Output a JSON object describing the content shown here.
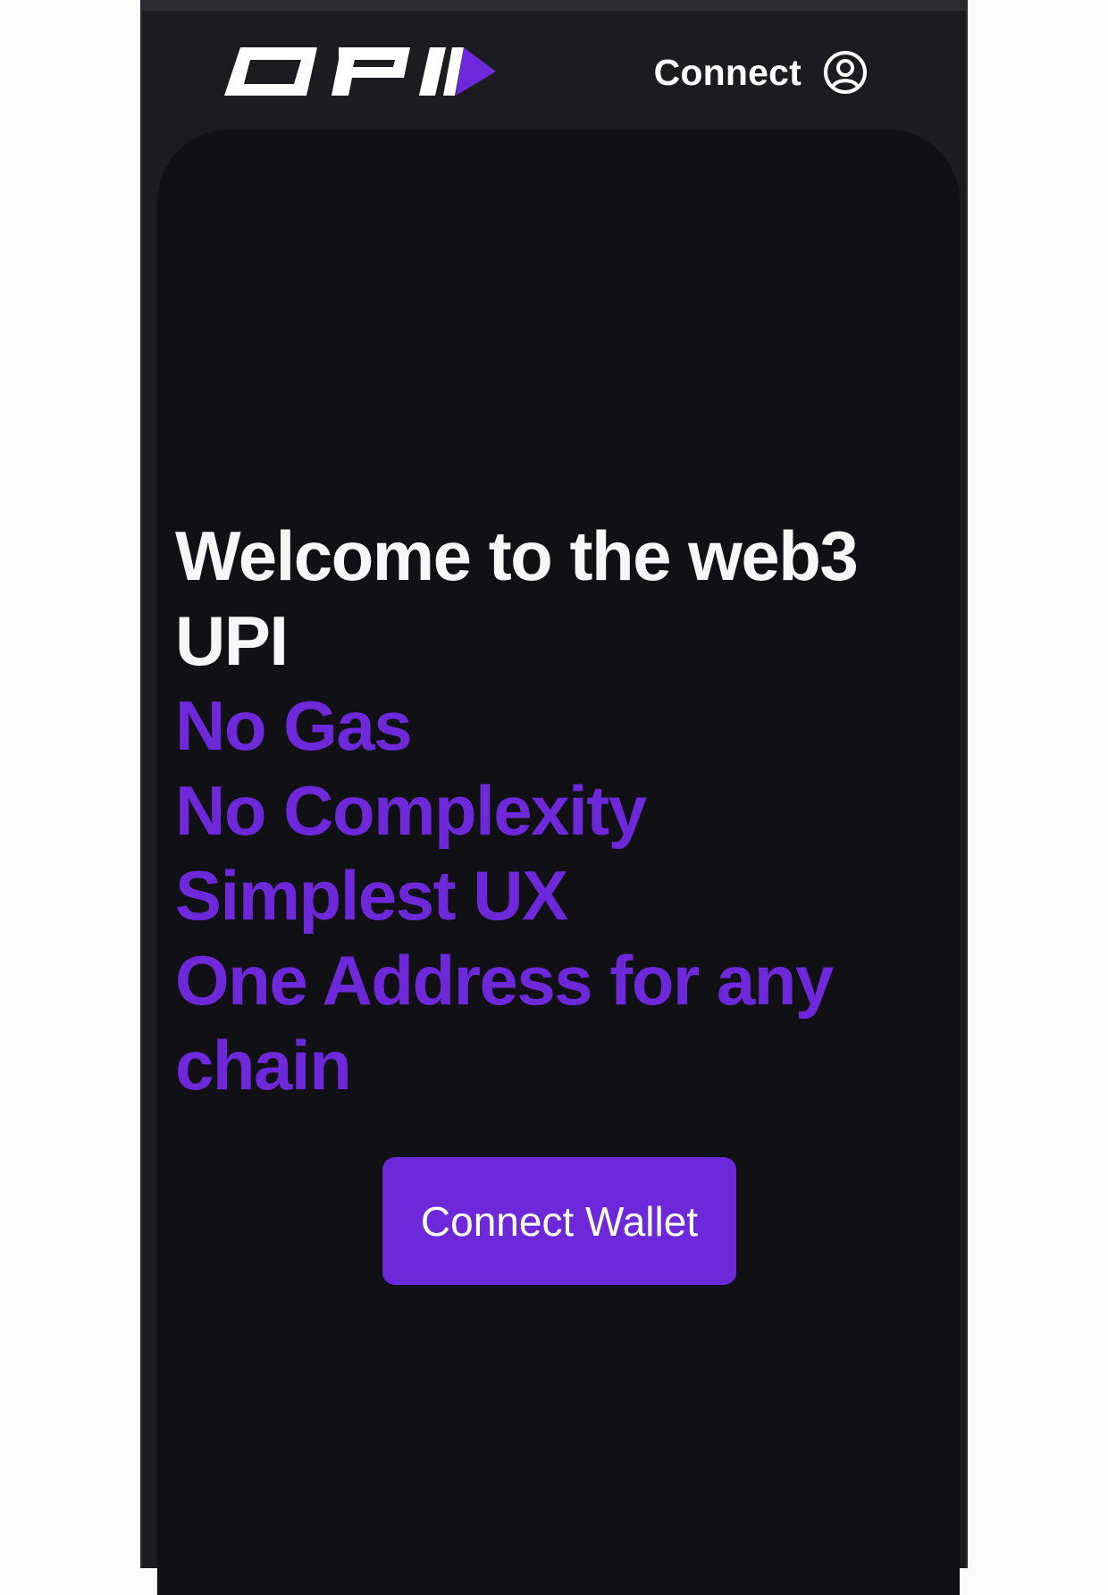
{
  "header": {
    "logo_text": "DPI",
    "connect_label": "Connect",
    "user_icon": "user-circle-icon"
  },
  "hero": {
    "title": "Welcome to the web3 UPI",
    "features": [
      "No Gas",
      "No Complexity",
      "Simplest UX",
      "One Address for any chain"
    ]
  },
  "cta": {
    "label": "Connect Wallet"
  },
  "colors": {
    "background": "#1c1c20",
    "panel": "#111115",
    "accent": "#6d28d9",
    "text": "#f7f7f7"
  }
}
